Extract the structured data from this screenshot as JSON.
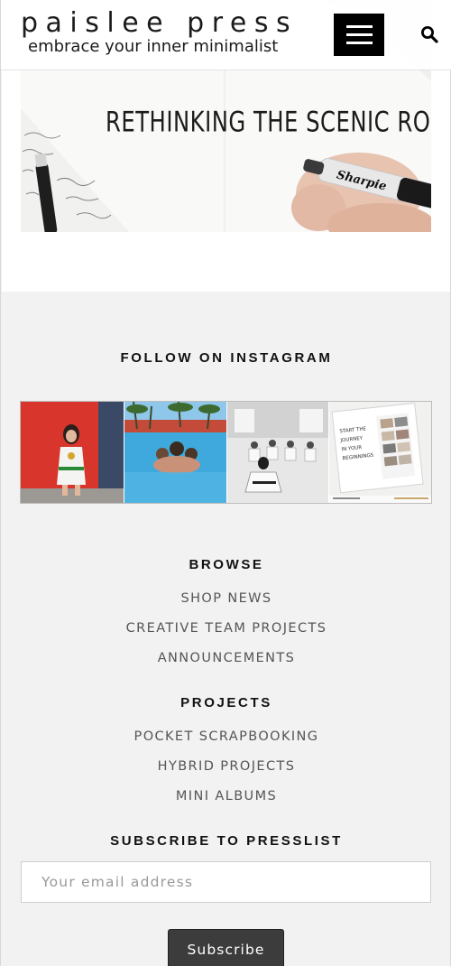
{
  "header": {
    "brand_name": "paislee press",
    "tagline": "embrace your inner minimalist",
    "menu_icon": "hamburger-menu-icon",
    "search_icon": "search-icon"
  },
  "hero": {
    "title": "RETHINKING THE SCENIC ROUTE",
    "marker_brand": "Sharpie"
  },
  "instagram": {
    "heading": "FOLLOW ON INSTAGRAM",
    "card_text": "START THE JOURNEY IN YOUR BEGINNINGS"
  },
  "browse": {
    "heading": "BROWSE",
    "links": [
      "SHOP NEWS",
      "CREATIVE TEAM PROJECTS",
      "ANNOUNCEMENTS"
    ]
  },
  "projects": {
    "heading": "PROJECTS",
    "links": [
      "POCKET SCRAPBOOKING",
      "HYBRID PROJECTS",
      "MINI ALBUMS"
    ]
  },
  "subscribe": {
    "heading": "SUBSCRIBE TO PRESSLIST",
    "email_placeholder": "Your email address",
    "button_label": "Subscribe"
  },
  "colors": {
    "background": "#f2f2f2",
    "button": "#3c3c3c",
    "menu_button": "#000000"
  }
}
